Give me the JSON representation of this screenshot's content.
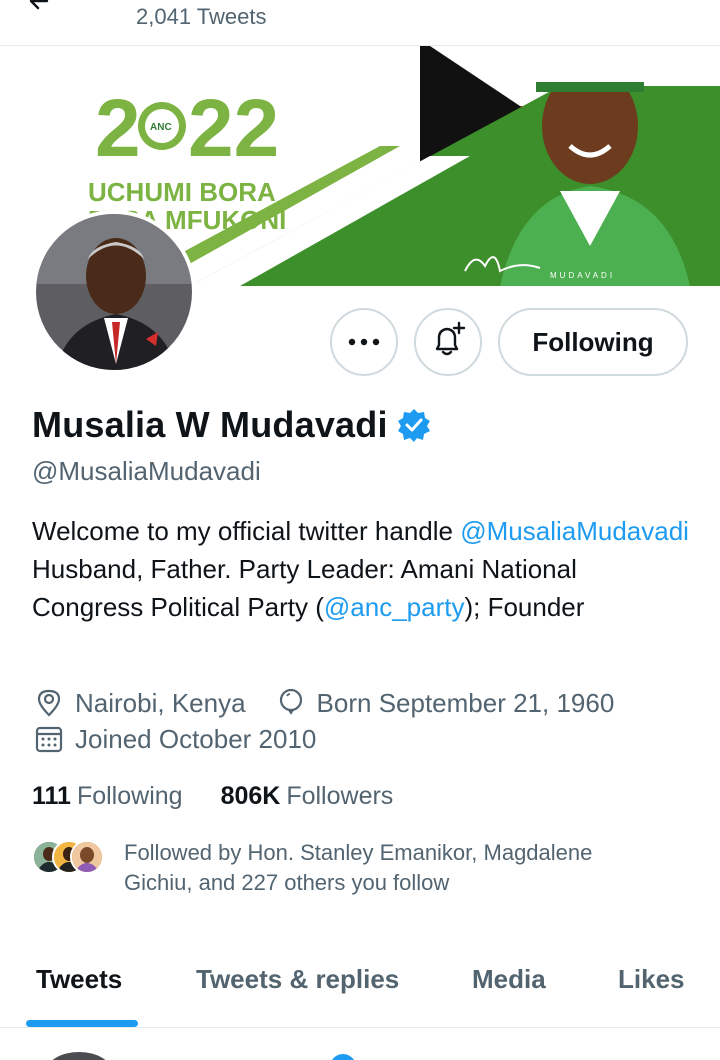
{
  "header": {
    "tweet_count": "2,041 Tweets"
  },
  "banner": {
    "year_digits_left": "2",
    "year_digits_right": "22",
    "badge_text": "ANC",
    "slogan_line1": "UCHUMI BORA",
    "slogan_line2": "PESA MFUKONI",
    "signature": "MUDAVADI",
    "colors": {
      "green": "#7cb342",
      "red": "#d32f2f",
      "black": "#111111"
    }
  },
  "profile": {
    "display_name": "Musalia W Mudavadi",
    "handle": "@MusaliaMudavadi",
    "verified": true,
    "bio": {
      "part1": "Welcome to my official twitter handle ",
      "mention1": "@MusaliaMudavadi",
      "part2": " Husband, Father. Party Leader: Amani National Congress Political Party (",
      "mention2": "@anc_party",
      "part3": "); Founder"
    },
    "location": "Nairobi, Kenya",
    "birthday": "Born September 21, 1960",
    "joined": "Joined October 2010",
    "following_count": "111",
    "following_label": "Following",
    "followers_count": "806K",
    "followers_label": "Followers",
    "followed_by": "Followed by Hon. Stanley Emanikor, Magdalene Gichiu, and 227 others you follow"
  },
  "actions": {
    "more_icon": "more-icon",
    "notify_icon": "bell-plus-icon",
    "following_button": "Following"
  },
  "tabs": [
    {
      "label": "Tweets",
      "active": true
    },
    {
      "label": "Tweets & replies",
      "active": false
    },
    {
      "label": "Media",
      "active": false
    },
    {
      "label": "Likes",
      "active": false
    }
  ],
  "accent_color": "#1d9bf0"
}
